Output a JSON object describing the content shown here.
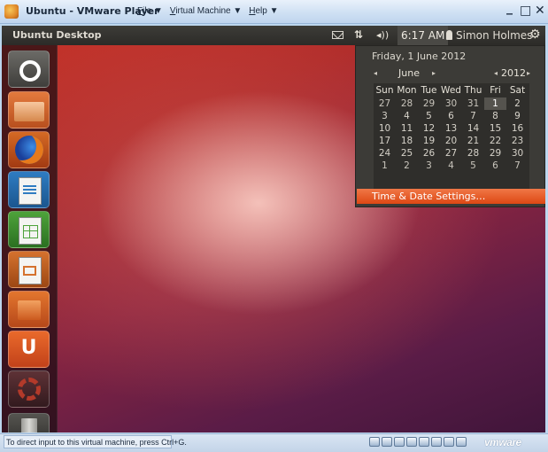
{
  "vmware": {
    "title": "Ubuntu - VMware Player",
    "menus": [
      {
        "label": "File",
        "underline": "F",
        "rest": "ile"
      },
      {
        "label": "Virtual Machine",
        "underline": "V",
        "rest": "irtual Machine"
      },
      {
        "label": "Help",
        "underline": "H",
        "rest": "elp"
      }
    ],
    "menu_arrow": "▼",
    "minimize_glyph": "_",
    "maximize_glyph": "□",
    "close_glyph": "✕",
    "status_text": "To direct input to this virtual machine, press Ctrl+G.",
    "status_logo": "vmware",
    "status_icons": [
      "hard-disk-icon",
      "cd-dvd-icon",
      "floppy-icon",
      "network-icon",
      "usb-icon",
      "printer-icon",
      "sound-icon",
      "display-icon"
    ]
  },
  "topbar": {
    "title": "Ubuntu Desktop",
    "clock": "6:17 AM",
    "user": "Simon Holmes",
    "net_glyph": "⇅",
    "vol_glyph": "◂))",
    "gear_glyph": "⚙"
  },
  "launcher": {
    "items": [
      "dash-icon",
      "home-folder-icon",
      "firefox-icon",
      "libreoffice-writer-icon",
      "libreoffice-calc-icon",
      "libreoffice-impress-icon",
      "ubuntu-software-center-icon",
      "ubuntu-one-icon",
      "system-settings-icon",
      "trash-icon"
    ],
    "ubuntu_one_letter": "U"
  },
  "calendar": {
    "date_label": "Friday,  1 June 2012",
    "month": "June",
    "year": "2012",
    "prev_arrow": "◂",
    "next_arrow": "▸",
    "weekdays": [
      "Sun",
      "Mon",
      "Tue",
      "Wed",
      "Thu",
      "Fri",
      "Sat"
    ],
    "weeks": [
      [
        "27",
        "28",
        "29",
        "30",
        "31",
        "1",
        "2"
      ],
      [
        "3",
        "4",
        "5",
        "6",
        "7",
        "8",
        "9"
      ],
      [
        "10",
        "11",
        "12",
        "13",
        "14",
        "15",
        "16"
      ],
      [
        "17",
        "18",
        "19",
        "20",
        "21",
        "22",
        "23"
      ],
      [
        "24",
        "25",
        "26",
        "27",
        "28",
        "29",
        "30"
      ],
      [
        "1",
        "2",
        "3",
        "4",
        "5",
        "6",
        "7"
      ]
    ],
    "settings_label": "Time & Date Settings…",
    "accent_color": "#dd4814"
  }
}
